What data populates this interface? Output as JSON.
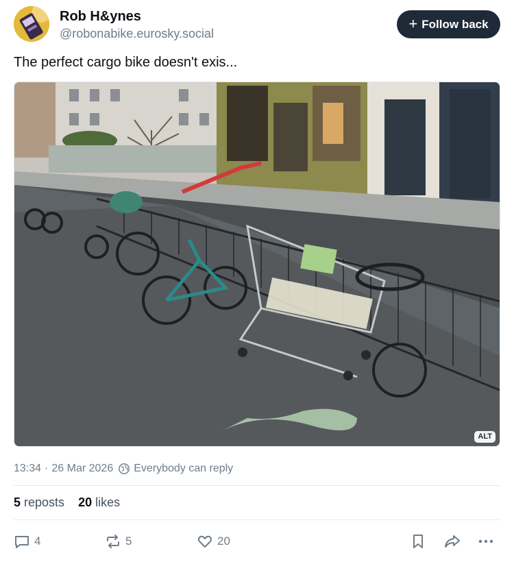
{
  "author": {
    "display_name": "Rob H&ynes",
    "handle": "@robonabike.eurosky.social",
    "follow_label": "Follow back"
  },
  "post": {
    "text": "The perfect cargo bike doesn't exis...",
    "image_alt_badge": "ALT"
  },
  "meta": {
    "time": "13:34",
    "separator": "·",
    "date": "26 Mar 2026",
    "reply_setting": "Everybody can reply"
  },
  "stats": {
    "reposts_count": "5",
    "reposts_label": "reposts",
    "likes_count": "20",
    "likes_label": "likes"
  },
  "actions": {
    "reply_count": "4",
    "repost_count": "5",
    "like_count": "20"
  },
  "icons": [
    "plus-icon",
    "globe-icon",
    "reply-icon",
    "repost-icon",
    "heart-icon",
    "bookmark-icon",
    "share-icon",
    "more-icon"
  ],
  "colors": {
    "follow_button": "#1f2a38",
    "text_primary": "#0b0f14",
    "text_secondary": "#6f7c89",
    "divider": "#e6e9ec"
  }
}
